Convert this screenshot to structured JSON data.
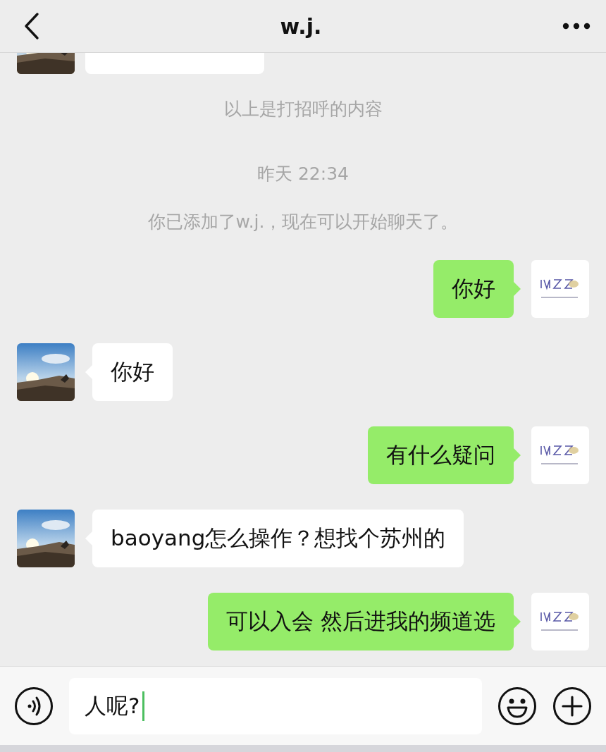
{
  "header": {
    "title": "w.j."
  },
  "messages": [
    {
      "kind": "partial",
      "outgoing": false
    },
    {
      "kind": "system",
      "text": "以上是打招呼的内容"
    },
    {
      "kind": "time",
      "text": "昨天 22:34"
    },
    {
      "kind": "system",
      "text": "你已添加了w.j.，现在可以开始聊天了。"
    },
    {
      "kind": "bubble",
      "outgoing": true,
      "text": "你好"
    },
    {
      "kind": "bubble",
      "outgoing": false,
      "text": "你好"
    },
    {
      "kind": "bubble",
      "outgoing": true,
      "text": "有什么疑问"
    },
    {
      "kind": "bubble",
      "outgoing": false,
      "text": "baoyang怎么操作？想找个苏州的"
    },
    {
      "kind": "bubble",
      "outgoing": true,
      "text": "可以入会 然后进我的频道选"
    }
  ],
  "composer": {
    "value": "人呢?"
  }
}
